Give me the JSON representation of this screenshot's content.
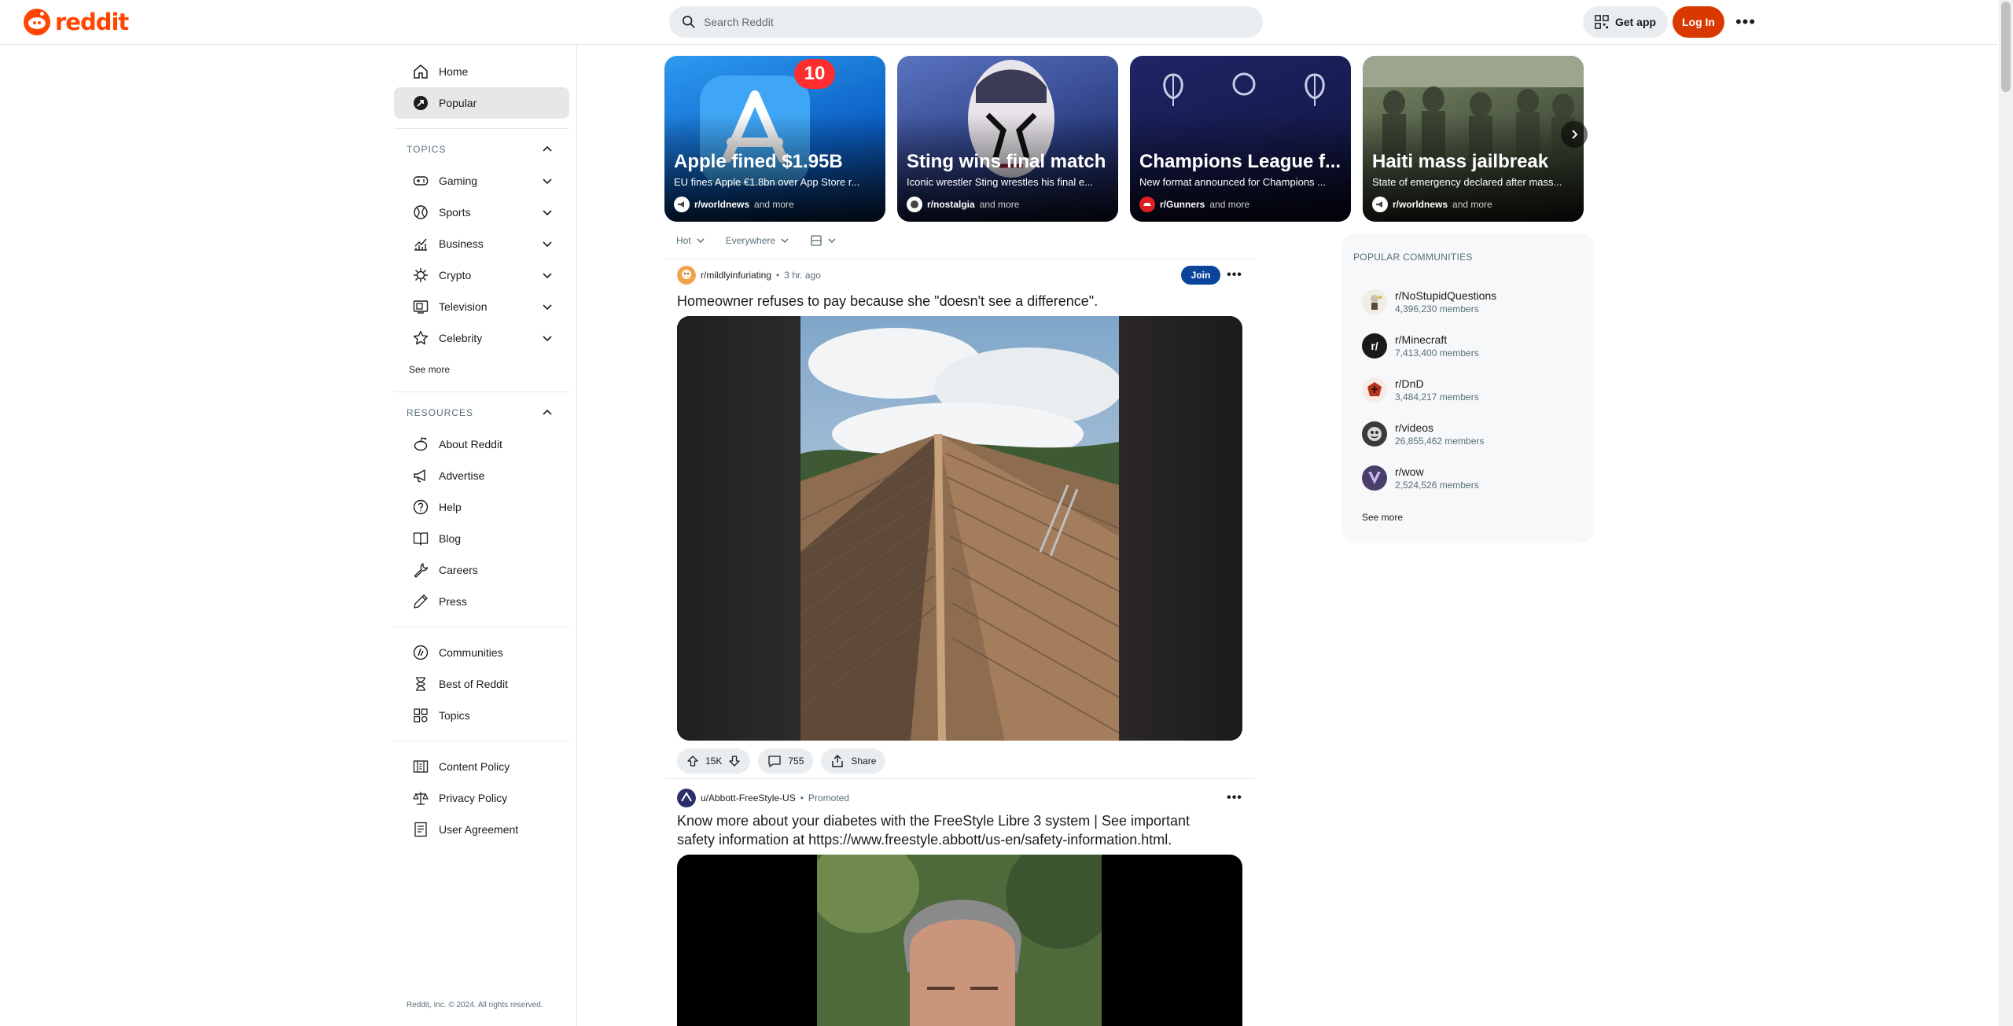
{
  "header": {
    "logo_text": "reddit",
    "search_placeholder": "Search Reddit",
    "get_app_label": "Get app",
    "login_label": "Log In"
  },
  "sidebar": {
    "main": [
      {
        "label": "Home",
        "icon": "home-icon"
      },
      {
        "label": "Popular",
        "icon": "popular-icon"
      }
    ],
    "topics_heading": "TOPICS",
    "topics": [
      {
        "label": "Gaming",
        "icon": "gamepad-icon"
      },
      {
        "label": "Sports",
        "icon": "sports-icon"
      },
      {
        "label": "Business",
        "icon": "chart-icon"
      },
      {
        "label": "Crypto",
        "icon": "crypto-icon"
      },
      {
        "label": "Television",
        "icon": "tv-icon"
      },
      {
        "label": "Celebrity",
        "icon": "star-icon"
      }
    ],
    "topics_see_more": "See more",
    "resources_heading": "RESOURCES",
    "resources": [
      {
        "label": "About Reddit",
        "icon": "reddit-icon"
      },
      {
        "label": "Advertise",
        "icon": "megaphone-icon"
      },
      {
        "label": "Help",
        "icon": "help-icon"
      },
      {
        "label": "Blog",
        "icon": "book-icon"
      },
      {
        "label": "Careers",
        "icon": "wrench-icon"
      },
      {
        "label": "Press",
        "icon": "pen-icon"
      }
    ],
    "links": [
      {
        "label": "Communities",
        "icon": "communities-icon"
      },
      {
        "label": "Best of Reddit",
        "icon": "hourglass-icon"
      },
      {
        "label": "Topics",
        "icon": "grid-icon"
      }
    ],
    "policies": [
      {
        "label": "Content Policy",
        "icon": "policy-icon"
      },
      {
        "label": "Privacy Policy",
        "icon": "scale-icon"
      },
      {
        "label": "User Agreement",
        "icon": "document-icon"
      }
    ],
    "copyright": "Reddit, Inc. © 2024. All rights reserved."
  },
  "carousel": [
    {
      "title": "Apple fined $1.95B",
      "subtitle": "EU fines Apple €1.8bn over App Store r...",
      "source": "r/worldnews",
      "and_more": "and more",
      "badge": "10",
      "bg": "#1e7fd8"
    },
    {
      "title": "Sting wins final match",
      "subtitle": "Iconic wrestler Sting wrestles his final e...",
      "source": "r/nostalgia",
      "and_more": "and more",
      "bg": "#3b4f9a"
    },
    {
      "title": "Champions League f...",
      "subtitle": "New format announced for Champions ...",
      "source": "r/Gunners",
      "and_more": "and more",
      "bg": "#1b1f56"
    },
    {
      "title": "Haiti mass jailbreak",
      "subtitle": "State of emergency declared after mass...",
      "source": "r/worldnews",
      "and_more": "and more",
      "bg": "#4c5742"
    }
  ],
  "feed": {
    "sort_label": "Hot",
    "location_label": "Everywhere"
  },
  "posts": [
    {
      "subreddit": "r/mildlyinfuriating",
      "time": "3 hr. ago",
      "join_label": "Join",
      "title": "Homeowner refuses to pay because she \"doesn't see a difference\".",
      "votes": "15K",
      "comments": "755",
      "share_label": "Share"
    },
    {
      "author": "u/Abbott-FreeStyle-US",
      "promoted_label": "Promoted",
      "title_line1": "Know more about your diabetes with the FreeStyle Libre 3 system | See important",
      "title_line2": "safety information at https://www.freestyle.abbott/us-en/safety-information.html."
    }
  ],
  "popular_communities": {
    "heading": "POPULAR COMMUNITIES",
    "items": [
      {
        "name": "r/NoStupidQuestions",
        "members": "4,396,230 members",
        "color": "#e9e4da"
      },
      {
        "name": "r/Minecraft",
        "members": "7,413,400 members",
        "color": "#1a1a1b"
      },
      {
        "name": "r/DnD",
        "members": "3,484,217 members",
        "color": "#b5341f"
      },
      {
        "name": "r/videos",
        "members": "26,855,462 members",
        "color": "#3a3a3a"
      },
      {
        "name": "r/wow",
        "members": "2,524,526 members",
        "color": "#4a3f6b"
      }
    ],
    "see_more": "See more"
  },
  "colors": {
    "brand": "#ff4500",
    "login": "#d93900",
    "join": "#0a449b"
  }
}
